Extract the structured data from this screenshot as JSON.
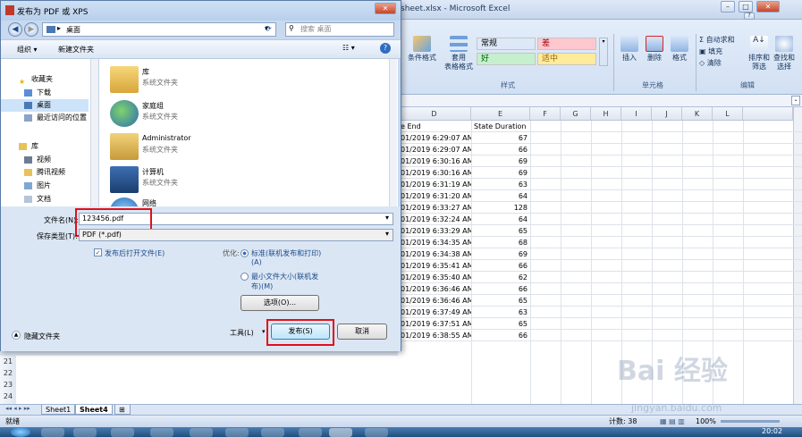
{
  "excel": {
    "title": "sheet.xlsx - Microsoft Excel",
    "ribbon": {
      "conditional_format": "条件格式",
      "table_format_1": "套用",
      "table_format_2": "表格格式",
      "styles": [
        "常规",
        "差",
        "好",
        "适中"
      ],
      "style_colors": [
        "#ffffff",
        "#ffc7ce",
        "#c6efce",
        "#ffeb9c"
      ],
      "styles_group": "样式",
      "insert": "插入",
      "delete": "删除",
      "format": "格式",
      "cells_group": "单元格",
      "autosum": "自动求和",
      "fill": "填充",
      "clear": "清除",
      "sort_filter_1": "排序和",
      "sort_filter_2": "筛选",
      "find_select_1": "查找和",
      "find_select_2": "选择",
      "editing_group": "编辑"
    },
    "columns": [
      "D",
      "E",
      "F",
      "G",
      "H",
      "I",
      "J",
      "K",
      "L"
    ],
    "header_row": {
      "d": "e End",
      "e": "State Duration"
    },
    "rows": [
      {
        "d": "01/2019 6:29:07 AM",
        "e": "67"
      },
      {
        "d": "01/2019 6:29:07 AM",
        "e": "66"
      },
      {
        "d": "01/2019 6:30:16 AM",
        "e": "69"
      },
      {
        "d": "01/2019 6:30:16 AM",
        "e": "69"
      },
      {
        "d": "01/2019 6:31:19 AM",
        "e": "63"
      },
      {
        "d": "01/2019 6:31:20 AM",
        "e": "64"
      },
      {
        "d": "01/2019 6:33:27 AM",
        "e": "128"
      },
      {
        "d": "01/2019 6:32:24 AM",
        "e": "64"
      },
      {
        "d": "01/2019 6:33:29 AM",
        "e": "65"
      },
      {
        "d": "01/2019 6:34:35 AM",
        "e": "68"
      },
      {
        "d": "01/2019 6:34:38 AM",
        "e": "69"
      },
      {
        "d": "01/2019 6:35:41 AM",
        "e": "66"
      },
      {
        "d": "01/2019 6:35:40 AM",
        "e": "62"
      },
      {
        "d": "01/2019 6:36:46 AM",
        "e": "66"
      },
      {
        "d": "01/2019 6:36:46 AM",
        "e": "65"
      },
      {
        "d": "01/2019 6:37:49 AM",
        "e": "63"
      },
      {
        "d": "01/2019 6:37:51 AM",
        "e": "65"
      },
      {
        "d": "01/2019 6:38:55 AM",
        "e": "66"
      }
    ],
    "row_numbers": [
      "21",
      "22",
      "23",
      "24"
    ],
    "sheet_tabs": [
      "Sheet1",
      "Sheet4"
    ],
    "status_ready": "就绪",
    "status_count": "计数: 38",
    "zoom": "100%",
    "clock": "20:02"
  },
  "dialog": {
    "title": "发布为 PDF 或 XPS",
    "address": "桌面",
    "search_placeholder": "搜索 桌面",
    "organize": "组织 ▾",
    "new_folder": "新建文件夹",
    "nav_items": [
      "收藏夹",
      "下载",
      "桌面",
      "最近访问的位置",
      "库",
      "视频",
      "腾讯视频",
      "图片",
      "文档"
    ],
    "files": [
      {
        "name": "库",
        "desc": "系统文件夹"
      },
      {
        "name": "家庭组",
        "desc": "系统文件夹"
      },
      {
        "name": "Administrator",
        "desc": "系统文件夹"
      },
      {
        "name": "计算机",
        "desc": "系统文件夹"
      },
      {
        "name": "网络",
        "desc": ""
      }
    ],
    "filename_label": "文件名(N):",
    "filename_value": "123456.pdf",
    "filetype_label": "保存类型(T):",
    "filetype_value": "PDF (*.pdf)",
    "open_after": "发布后打开文件(E)",
    "optimize_label": "优化:",
    "opt_standard_1": "标准(联机发布和打印)",
    "opt_standard_2": "(A)",
    "opt_min_1": "最小文件大小(联机发",
    "opt_min_2": "布)(M)",
    "options_button": "选项(O)...",
    "hide_folders": "隐藏文件夹",
    "tools": "工具(L)",
    "publish": "发布(S)",
    "cancel": "取消"
  },
  "watermark": {
    "logo": "Bai 经验",
    "url": "jingyan.baidu.com"
  }
}
